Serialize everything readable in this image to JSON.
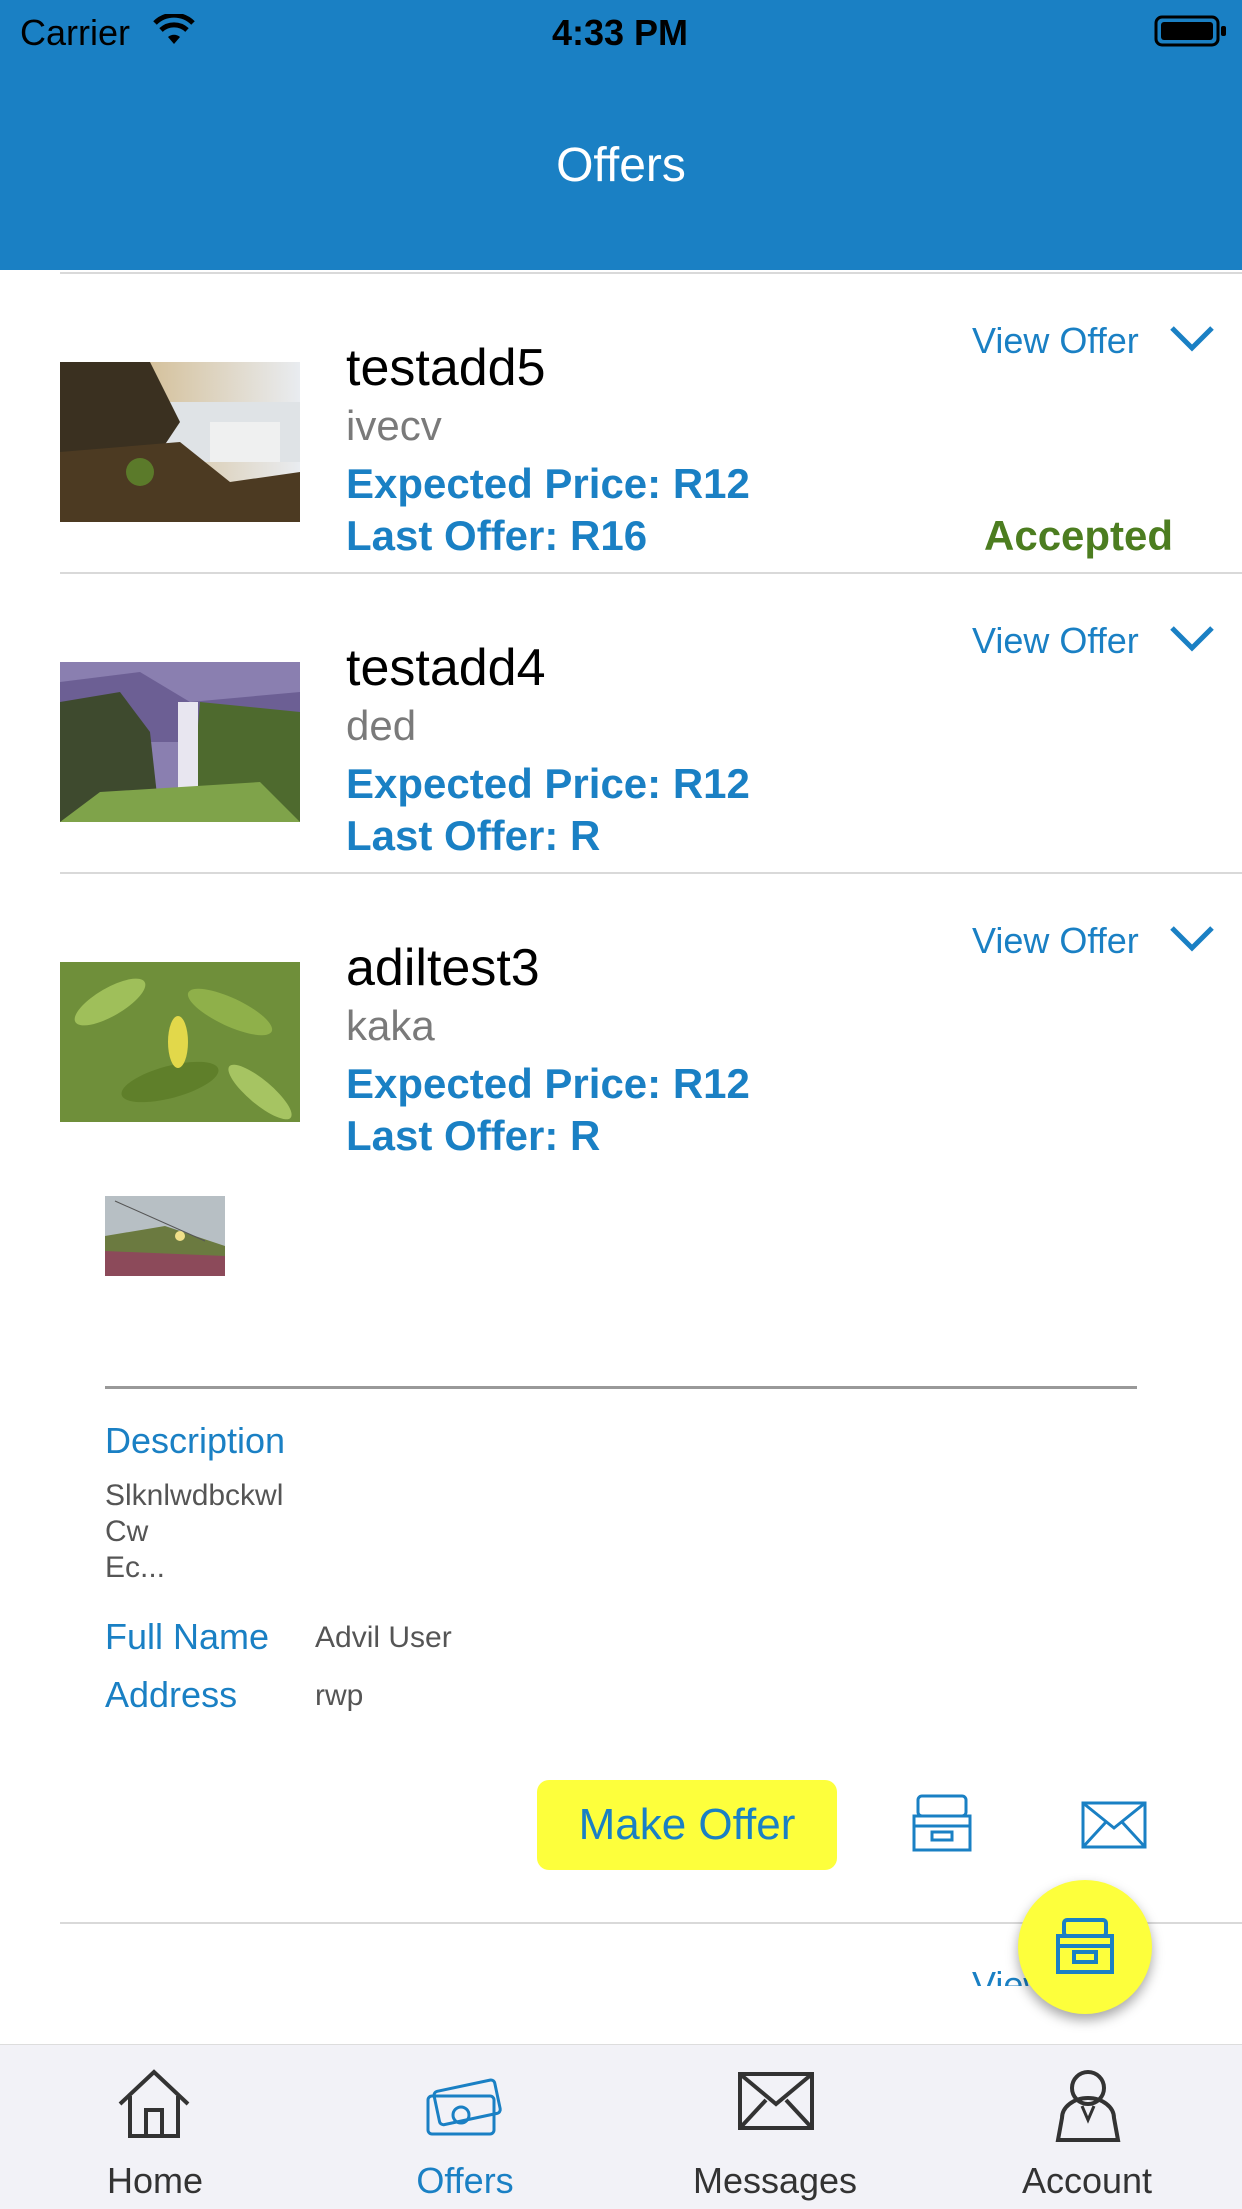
{
  "status": {
    "carrier": "Carrier",
    "time": "4:33 PM"
  },
  "header": {
    "title": "Offers"
  },
  "offers": [
    {
      "name": "testadd5",
      "subtitle": "ivecv",
      "expected": "Expected Price: R12",
      "last": "Last Offer: R16",
      "view": "View Offer",
      "status": "Accepted"
    },
    {
      "name": "testadd4",
      "subtitle": "ded",
      "expected": "Expected Price: R12",
      "last": "Last Offer: R",
      "view": "View Offer",
      "status": ""
    },
    {
      "name": "adiltest3",
      "subtitle": "kaka",
      "expected": "Expected Price: R12",
      "last": "Last Offer: R",
      "view": "View Offer",
      "status": ""
    }
  ],
  "details": {
    "description_label": "Description",
    "description_value": "Slknlwdbckwl\nCw\nEc...",
    "fullname_label": "Full Name",
    "fullname_value": "Advil User",
    "address_label": "Address",
    "address_value": "rwp",
    "make_offer": "Make Offer"
  },
  "tabs": [
    {
      "label": "Home",
      "icon": "home-icon",
      "active": false
    },
    {
      "label": "Offers",
      "icon": "offers-icon",
      "active": true
    },
    {
      "label": "Messages",
      "icon": "messages-icon",
      "active": false
    },
    {
      "label": "Account",
      "icon": "account-icon",
      "active": false
    }
  ],
  "colors": {
    "accent": "#1a80c4",
    "accepted": "#4c7d20",
    "button": "#fdff3c"
  }
}
